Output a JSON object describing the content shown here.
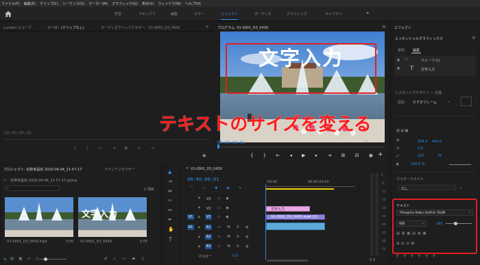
{
  "menubar": [
    "ファイル(F)",
    "編集(E)",
    "クリップ(C)",
    "シーケンス(S)",
    "マーカー(M)",
    "グラフィック(G)",
    "表示(V)",
    "ウィンドウ(W)",
    "ヘルプ(H)"
  ],
  "workspaces": [
    "学習",
    "アセンブリ",
    "編集",
    "カラー",
    "エフェクト",
    "オーディオ",
    "グラフィック",
    "ライブラリ"
  ],
  "workspace_more": "»",
  "source_panel": {
    "tabs": [
      "Lumetri スコープ",
      "ソース：(クリップなし)",
      "オーディオクリップミキサー：V1-0001_D3_0430"
    ],
    "more": "»",
    "timecode": "00;00;00;00"
  },
  "program": {
    "title": "プログラム: V1-0001_D3_0430",
    "title_overlay": "文字入力",
    "timecode": "00:00:00:01",
    "partial_label": "フル"
  },
  "annotation": "テキストのサイズを変える",
  "project": {
    "tab": "プロジェクト: 名称未設定-2020-04-06_21-57-17",
    "tab2": "メディアブラウザー",
    "path": "名称未設定-2020-04-06_21-57-17.prproj",
    "count": "2 項目",
    "clips": [
      {
        "name": "V1-0001_D3_0430.mp4",
        "duration": "5:05"
      },
      {
        "name": "V1-0001_D3_0430",
        "duration": "5:05",
        "overlay": "文字入力"
      }
    ]
  },
  "timeline": {
    "tab": "V1-0001_D3_0430",
    "timecode": "00:00:00:01",
    "ruler": [
      ":00:00",
      "00:00:04:00"
    ],
    "video_tracks": [
      "V3",
      "V2",
      "V1"
    ],
    "audio_tracks": [
      "A1",
      "A2",
      "A3"
    ],
    "master_label": "マスター",
    "master_value": "0.0",
    "text_clip": "文字入力",
    "video_clip": "V1-0001_D3_0430.mp4 [V]"
  },
  "audio_meter": {
    "ticks": [
      "0",
      "-6",
      "-12",
      "-18",
      "-24",
      "-30",
      "-36",
      "-42",
      "-48",
      "-54"
    ],
    "bottom": "S S"
  },
  "essential_graphics": {
    "panel_title": "エフェクト",
    "header": "エッセンシャルグラフィックス",
    "tabs": [
      "参照",
      "編集"
    ],
    "layers": [
      {
        "name": "グループ 01"
      },
      {
        "name": "文字入力"
      }
    ],
    "responsive_label": "レスポンシブデザイン － 位置",
    "pin_label": "固定：",
    "pin_value": "ビデオフレーム",
    "position": [
      "204.4",
      "442.0"
    ],
    "rotation": "0.0",
    "scale_w": "237",
    "scale_h": "75",
    "opacity": "100.0 %",
    "master_style_label": "マスタースタイル",
    "master_style_value": "なし",
    "text_label": "テキスト",
    "font": "Hiragino Kaku Gothic StdN",
    "weight": "W8",
    "size": "165"
  },
  "colors": {
    "accent": "#2d8ceb",
    "annotation": "#ff1a1a",
    "highlight_box": "#e02020",
    "text_clip": "#e9a7e4",
    "video_clip": "#8b86d9",
    "audio_clip": "#5da9d8"
  }
}
